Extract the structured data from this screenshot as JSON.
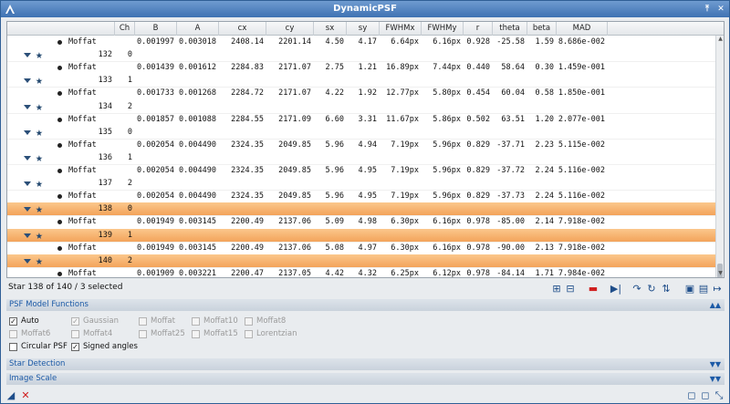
{
  "window": {
    "title": "DynamicPSF"
  },
  "table": {
    "headers": [
      "Ch",
      "B",
      "A",
      "cx",
      "cy",
      "sx",
      "sy",
      "FWHMx",
      "FWHMy",
      "r",
      "theta",
      "beta",
      "MAD"
    ],
    "rows": [
      {
        "kind": "psf",
        "label": "Moffat",
        "vals": [
          "0.001997",
          "0.003018",
          "2408.14",
          "2201.14",
          "4.50",
          "4.17",
          "6.64px",
          "6.16px",
          "0.928",
          "-25.58",
          "1.59",
          "8.686e-002"
        ]
      },
      {
        "kind": "star",
        "id": "132",
        "ch": "0",
        "sel": false
      },
      {
        "kind": "psf",
        "label": "Moffat",
        "vals": [
          "0.001439",
          "0.001612",
          "2284.83",
          "2171.07",
          "2.75",
          "1.21",
          "16.89px",
          "7.44px",
          "0.440",
          "58.64",
          "0.30",
          "1.459e-001"
        ]
      },
      {
        "kind": "star",
        "id": "133",
        "ch": "1",
        "sel": false
      },
      {
        "kind": "psf",
        "label": "Moffat",
        "vals": [
          "0.001733",
          "0.001268",
          "2284.72",
          "2171.07",
          "4.22",
          "1.92",
          "12.77px",
          "5.80px",
          "0.454",
          "60.04",
          "0.58",
          "1.850e-001"
        ]
      },
      {
        "kind": "star",
        "id": "134",
        "ch": "2",
        "sel": false
      },
      {
        "kind": "psf",
        "label": "Moffat",
        "vals": [
          "0.001857",
          "0.001088",
          "2284.55",
          "2171.09",
          "6.60",
          "3.31",
          "11.67px",
          "5.86px",
          "0.502",
          "63.51",
          "1.20",
          "2.077e-001"
        ]
      },
      {
        "kind": "star",
        "id": "135",
        "ch": "0",
        "sel": false
      },
      {
        "kind": "psf",
        "label": "Moffat",
        "vals": [
          "0.002054",
          "0.004490",
          "2324.35",
          "2049.85",
          "5.96",
          "4.94",
          "7.19px",
          "5.96px",
          "0.829",
          "-37.71",
          "2.23",
          "5.115e-002"
        ]
      },
      {
        "kind": "star",
        "id": "136",
        "ch": "1",
        "sel": false
      },
      {
        "kind": "psf",
        "label": "Moffat",
        "vals": [
          "0.002054",
          "0.004490",
          "2324.35",
          "2049.85",
          "5.96",
          "4.95",
          "7.19px",
          "5.96px",
          "0.829",
          "-37.72",
          "2.24",
          "5.116e-002"
        ]
      },
      {
        "kind": "star",
        "id": "137",
        "ch": "2",
        "sel": false
      },
      {
        "kind": "psf",
        "label": "Moffat",
        "vals": [
          "0.002054",
          "0.004490",
          "2324.35",
          "2049.85",
          "5.96",
          "4.95",
          "7.19px",
          "5.96px",
          "0.829",
          "-37.73",
          "2.24",
          "5.116e-002"
        ]
      },
      {
        "kind": "star",
        "id": "138",
        "ch": "0",
        "sel": true
      },
      {
        "kind": "psf",
        "label": "Moffat",
        "vals": [
          "0.001949",
          "0.003145",
          "2200.49",
          "2137.06",
          "5.09",
          "4.98",
          "6.30px",
          "6.16px",
          "0.978",
          "-85.00",
          "2.14",
          "7.918e-002"
        ]
      },
      {
        "kind": "star",
        "id": "139",
        "ch": "1",
        "sel": true
      },
      {
        "kind": "psf",
        "label": "Moffat",
        "vals": [
          "0.001949",
          "0.003145",
          "2200.49",
          "2137.06",
          "5.08",
          "4.97",
          "6.30px",
          "6.16px",
          "0.978",
          "-90.00",
          "2.13",
          "7.918e-002"
        ]
      },
      {
        "kind": "star",
        "id": "140",
        "ch": "2",
        "sel": true
      },
      {
        "kind": "psf",
        "label": "Moffat",
        "vals": [
          "0.001909",
          "0.003221",
          "2200.47",
          "2137.05",
          "4.42",
          "4.32",
          "6.25px",
          "6.12px",
          "0.978",
          "-84.14",
          "1.71",
          "7.984e-002"
        ]
      }
    ]
  },
  "status": {
    "text": "Star  138 of  140 / 3 selected"
  },
  "sections": {
    "psf_model": "PSF Model Functions",
    "star_detection": "Star Detection",
    "image_scale": "Image Scale"
  },
  "options": {
    "auto": "Auto",
    "circular": "Circular PSF",
    "signed": "Signed angles",
    "gaussian": "Gaussian",
    "moffat": "Moffat",
    "moffat10": "Moffat10",
    "moffat8": "Moffat8",
    "moffat6": "Moffat6",
    "moffat4": "Moffat4",
    "moffat25": "Moffat25",
    "moffat15": "Moffat15",
    "lorentzian": "Lorentzian"
  },
  "colors": {
    "selected_row": "#f3a35a",
    "accent": "#1c5aa6"
  }
}
